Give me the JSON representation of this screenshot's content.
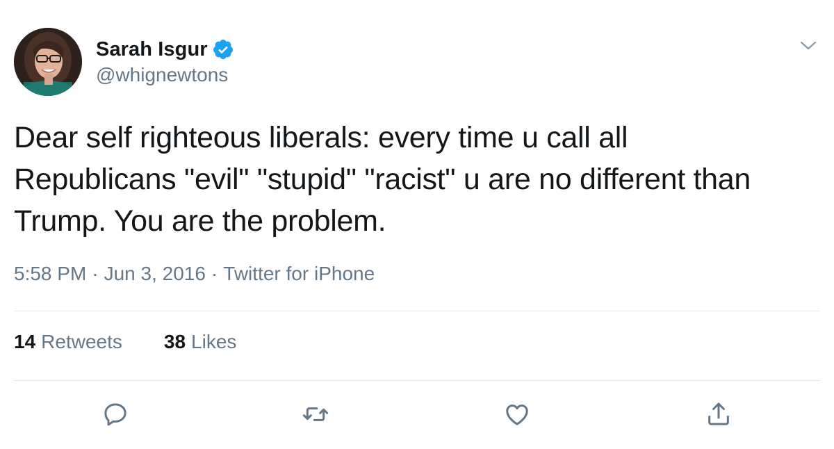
{
  "tweet": {
    "author": {
      "display_name": "Sarah Isgur",
      "handle": "@whignewtons",
      "verified": true
    },
    "text": "Dear self righteous liberals: every time u call all\nRepublicans \"evil\" \"stupid\" \"racist\" u are no different than\nTrump. You are the problem.",
    "time": "5:58 PM",
    "separator": "·",
    "date": "Jun 3, 2016",
    "source": "Twitter for iPhone",
    "stats": {
      "retweets_count": "14",
      "retweets_label": "Retweets",
      "likes_count": "38",
      "likes_label": "Likes"
    },
    "actions": [
      {
        "icon": "reply-icon"
      },
      {
        "icon": "retweet-icon"
      },
      {
        "icon": "like-icon"
      },
      {
        "icon": "share-icon"
      }
    ]
  },
  "colors": {
    "primary_text": "#14171a",
    "secondary_text": "#657786",
    "verified_blue": "#1da1f2",
    "divider": "#e1e8ed"
  }
}
